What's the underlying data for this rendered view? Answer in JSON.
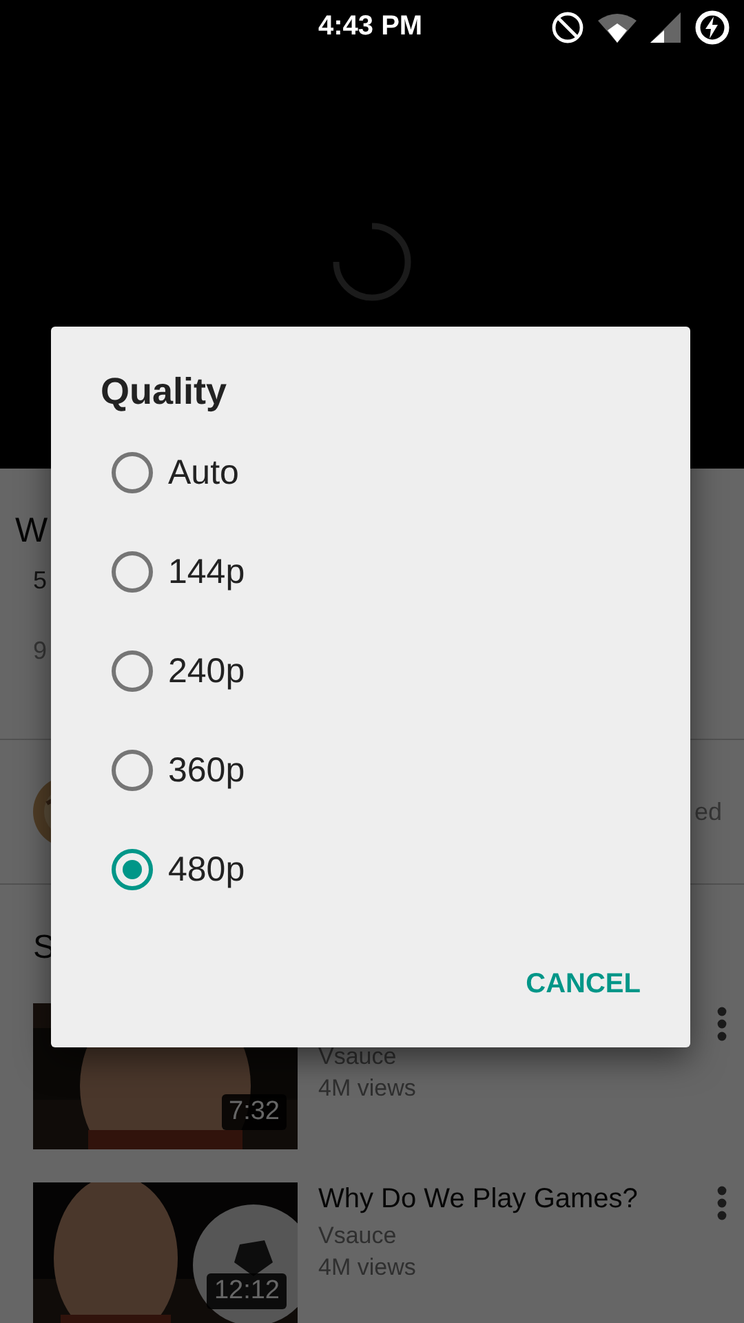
{
  "status_bar": {
    "time": "4:43 PM"
  },
  "video_info": {
    "title": "W",
    "line_2": "5",
    "line_3": "9"
  },
  "channel_row": {
    "right_text": "ed"
  },
  "section_heading": "S",
  "videos": [
    {
      "channel": "Vsauce",
      "views": "4M views",
      "duration": "7:32"
    },
    {
      "title": "Why Do We Play Games?",
      "channel": "Vsauce",
      "views": "4M views",
      "duration": "12:12"
    }
  ],
  "dialog": {
    "title": "Quality",
    "options": [
      {
        "label": "Auto",
        "selected": false
      },
      {
        "label": "144p",
        "selected": false
      },
      {
        "label": "240p",
        "selected": false
      },
      {
        "label": "360p",
        "selected": false
      },
      {
        "label": "480p",
        "selected": true
      }
    ],
    "buttons": [
      "CANCEL"
    ]
  }
}
